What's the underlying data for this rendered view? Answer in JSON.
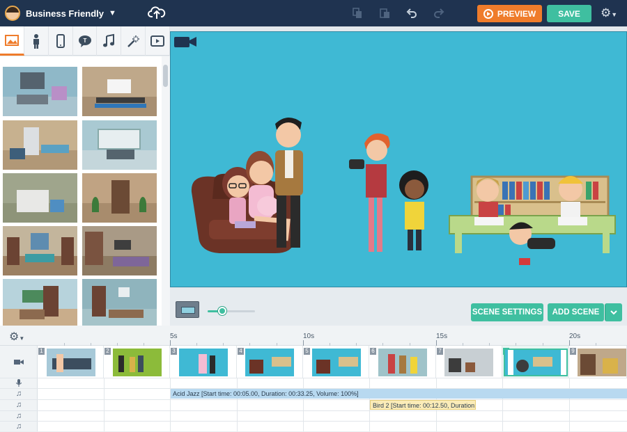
{
  "app": {
    "project_name": "Business Friendly",
    "preview_label": "PREVIEW",
    "save_label": "SAVE"
  },
  "library": {
    "tabs": [
      "backgrounds",
      "characters",
      "props",
      "text",
      "audio",
      "effects",
      "video"
    ],
    "active_tab": "backgrounds"
  },
  "stage": {
    "scene_settings_label": "SCENE SETTINGS",
    "add_scene_label": "ADD SCENE",
    "zoom_level": 0.3
  },
  "timeline": {
    "ticks": [
      "5s",
      "10s",
      "15s",
      "20s"
    ],
    "scenes": [
      "1",
      "2",
      "3",
      "4",
      "5",
      "6",
      "7",
      "8",
      "9"
    ],
    "selected_scene": "8",
    "audio_tracks": [
      {
        "label": "Acid Jazz [Start time: 00:05.00, Duration: 00:33.25, Volume: 100%]"
      },
      {
        "label": "Bird 2 [Start time: 00:12.50, Duration:"
      }
    ]
  },
  "colors": {
    "accent_orange": "#ef7c2b",
    "accent_green": "#3fbfa0",
    "topbar": "#1f3350",
    "stage_bg": "#3fb9d4"
  }
}
